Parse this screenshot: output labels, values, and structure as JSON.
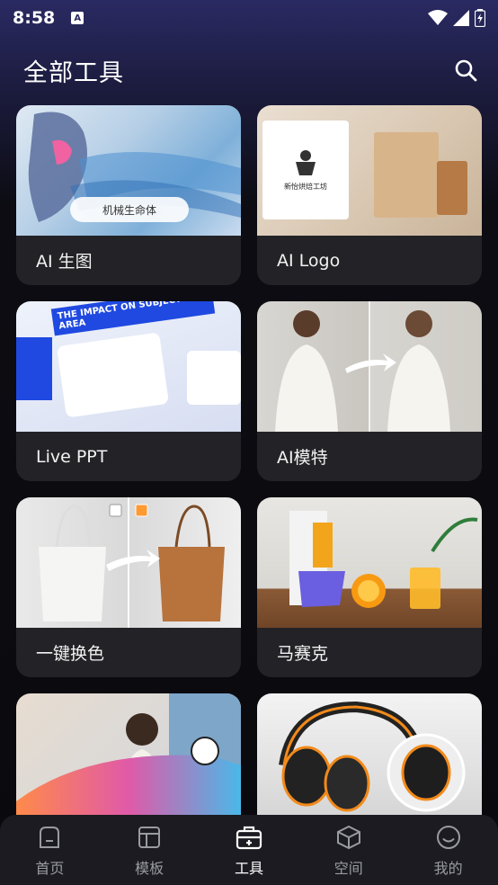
{
  "status_bar": {
    "time": "8:58",
    "app_icon_letter": "A"
  },
  "header": {
    "title": "全部工具"
  },
  "tools": [
    {
      "label": "AI 生图",
      "image_caption": "机械生命体",
      "image": "ai-gen"
    },
    {
      "label": "AI Logo",
      "image_caption": "新怡烘焙工坊",
      "image": "ai-logo"
    },
    {
      "label": "Live PPT",
      "image_caption": "THE IMPACT ON SUBJECT AREA",
      "image": "ppt"
    },
    {
      "label": "AI模特",
      "image": "model"
    },
    {
      "label": "一键换色",
      "image": "color"
    },
    {
      "label": "马赛克",
      "image": "mosaic"
    },
    {
      "label": "",
      "image": "person"
    },
    {
      "label": "",
      "image": "headphone"
    }
  ],
  "bottom_nav": [
    {
      "label": "首页",
      "icon": "home-icon",
      "active": false
    },
    {
      "label": "模板",
      "icon": "template-icon",
      "active": false
    },
    {
      "label": "工具",
      "icon": "toolbox-icon",
      "active": true
    },
    {
      "label": "空间",
      "icon": "cube-icon",
      "active": false
    },
    {
      "label": "我的",
      "icon": "smile-icon",
      "active": false
    }
  ],
  "colors": {
    "accent": "#ffffff",
    "card_bg": "#232327",
    "nav_bg": "#1b1b21",
    "muted": "#9a9aa2"
  }
}
